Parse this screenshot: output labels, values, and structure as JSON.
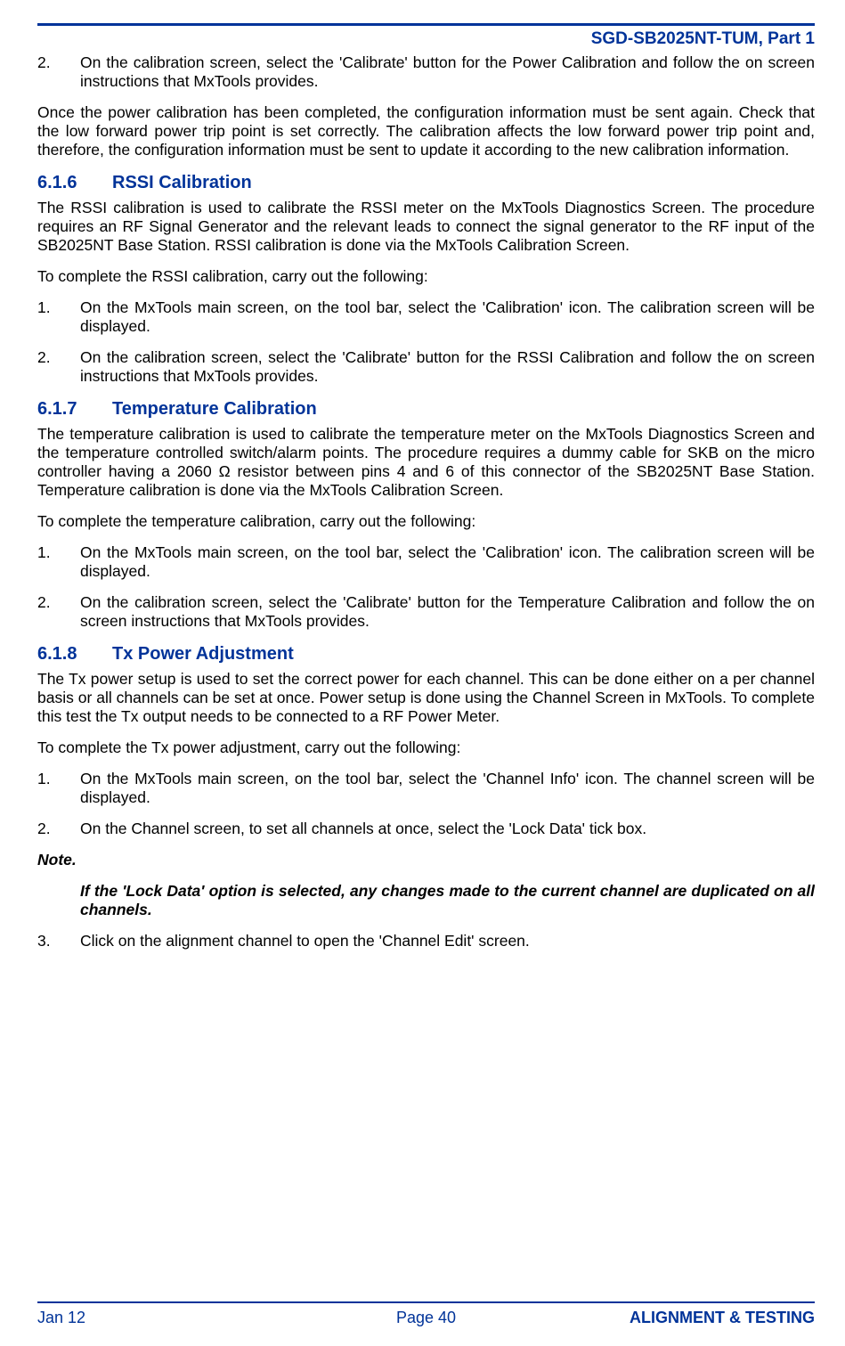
{
  "header": {
    "doc_id": "SGD-SB2025NT-TUM, Part 1"
  },
  "intro": {
    "step2_num": "2.",
    "step2_text": "On the calibration screen, select the 'Calibrate' button for the Power Calibration and follow the on screen instructions that MxTools provides.",
    "after": "Once the power calibration has been completed, the configuration information must be sent again. Check that the low forward power trip point is set correctly.  The calibration affects the low forward power trip point and, therefore, the configuration information must be sent to update it according to the new calibration information."
  },
  "sections": [
    {
      "num": "6.1.6",
      "title": "RSSI Calibration",
      "p1": "The RSSI calibration is used to calibrate the RSSI meter on the MxTools Diagnostics Screen.  The procedure requires an RF Signal Generator and the relevant leads to connect the signal generator to the RF input of the SB2025NT Base Station.  RSSI calibration is done via the MxTools Calibration Screen.",
      "p2": "To complete the RSSI calibration, carry out the following:",
      "steps": [
        {
          "n": "1.",
          "t": "On the MxTools main screen, on the tool bar, select the 'Calibration' icon.  The calibration screen will be displayed."
        },
        {
          "n": "2.",
          "t": "On the calibration screen, select the 'Calibrate' button for the RSSI Calibration and follow the on screen instructions that MxTools provides."
        }
      ]
    },
    {
      "num": "6.1.7",
      "title": "Temperature Calibration",
      "p1": "The temperature calibration is used to calibrate the temperature meter on the MxTools Diagnostics Screen and the temperature controlled switch/alarm points.  The procedure requires a dummy cable for SKB on the micro controller having a 2060 Ω resistor between pins 4 and 6 of this connector of the SB2025NT Base Station.  Temperature calibration is done via the MxTools Calibration Screen.",
      "p2": "To complete the temperature calibration, carry out the following:",
      "steps": [
        {
          "n": "1.",
          "t": "On the MxTools main screen, on the tool bar, select the 'Calibration' icon.  The calibration screen will be displayed."
        },
        {
          "n": "2.",
          "t": "On the calibration screen, select the 'Calibrate' button for the Temperature Calibration and follow the on screen instructions that MxTools provides."
        }
      ]
    },
    {
      "num": "6.1.8",
      "title": "Tx Power Adjustment",
      "p1": "The Tx power setup is used to set the correct power for each channel.  This can be done either on a per channel basis or all channels can be set at once.  Power setup is done using the Channel Screen in MxTools.  To complete this test the Tx output needs to be connected to a RF Power Meter.",
      "p2": "To complete the Tx power adjustment, carry out the following:",
      "steps": [
        {
          "n": "1.",
          "t": "On the MxTools main screen, on the tool bar, select the 'Channel Info' icon.  The channel screen will be displayed."
        },
        {
          "n": "2.",
          "t": "On the Channel screen, to set all channels at once, select the 'Lock Data' tick box."
        }
      ],
      "note_label": "Note.",
      "note_body": "If the 'Lock Data' option is selected, any changes made to the current channel are duplicated on all channels.",
      "steps_after": [
        {
          "n": "3.",
          "t": "Click on the alignment channel to open the 'Channel Edit' screen."
        }
      ]
    }
  ],
  "footer": {
    "left": "Jan 12",
    "center": "Page 40",
    "right": "ALIGNMENT & TESTING"
  }
}
